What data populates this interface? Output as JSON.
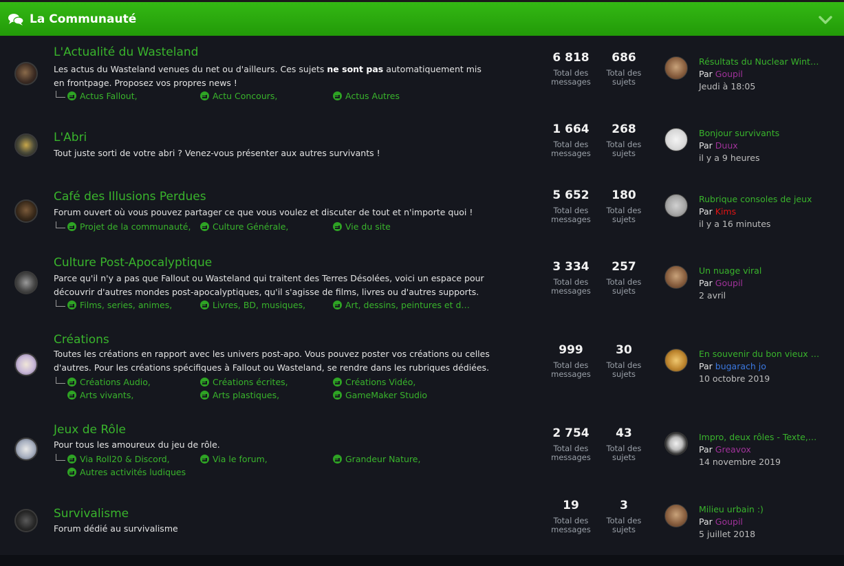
{
  "header": {
    "title": "La Communauté",
    "chat_icon": "chat-bubbles-icon",
    "collapse_icon": "chevron-down-icon"
  },
  "stats_labels": {
    "messages": "Total des messages",
    "topics": "Total des sujets"
  },
  "by_label": "Par",
  "forums": [
    {
      "title": "L'Actualité du Wasteland",
      "desc_parts": [
        "Les actus du Wasteland venues du net ou d'ailleurs. Ces sujets ",
        "ne sont pas",
        " automatiquement mis en frontpage. Proposez vos propres news !"
      ],
      "subforums": [
        "Actus Fallout,",
        "Actu Concours,",
        "Actus Autres"
      ],
      "messages": "6 818",
      "topics": "686",
      "last": {
        "title": "Résultats du Nuclear Winte…",
        "author": "Goupil",
        "author_color": "#a0329a",
        "date": "Jeudi à 18:05"
      }
    },
    {
      "title": "L'Abri",
      "desc_parts": [
        "Tout juste sorti de votre abri ? Venez-vous présenter aux autres survivants !"
      ],
      "subforums": [],
      "messages": "1 664",
      "topics": "268",
      "last": {
        "title": "Bonjour survivants",
        "author": "Duux",
        "author_color": "#a0329a",
        "date": "il y a 9 heures"
      }
    },
    {
      "title": "Café des Illusions Perdues",
      "desc_parts": [
        "Forum ouvert où vous pouvez partager ce que vous voulez et discuter de tout et n'importe quoi !"
      ],
      "subforums": [
        "Projet de la communauté,",
        "Culture Générale,",
        "Vie du site"
      ],
      "messages": "5 652",
      "topics": "180",
      "last": {
        "title": "Rubrique consoles de jeux",
        "author": "Kims",
        "author_color": "#e01414",
        "date": "il y a 16 minutes"
      }
    },
    {
      "title": "Culture Post-Apocalyptique",
      "desc_parts": [
        "Parce qu'il n'y a pas que Fallout ou Wasteland qui traitent des Terres Désolées, voici un espace pour découvrir d'autres mondes post-apocalyptiques, qu'il s'agisse de films, livres ou d'autres supports."
      ],
      "subforums": [
        "Films, series, animes,",
        "Livres, BD, musiques,",
        "Art, dessins, peintures et d…"
      ],
      "messages": "3 334",
      "topics": "257",
      "last": {
        "title": "Un nuage viral",
        "author": "Goupil",
        "author_color": "#a0329a",
        "date": "2 avril"
      }
    },
    {
      "title": "Créations",
      "desc_parts": [
        "Toutes les créations en rapport avec les univers post-apo. Vous pouvez poster vos créations ou celles d'autres. Pour les créations spécifiques à Fallout ou Wasteland, se rendre dans les rubriques dédiées."
      ],
      "subforums": [
        "Créations Audio,",
        "Créations écrites,",
        "Créations Vidéo,",
        "Arts vivants,",
        "Arts plastiques,",
        "GameMaker Studio"
      ],
      "messages": "999",
      "topics": "30",
      "last": {
        "title": "En souvenir du bon vieux t…",
        "author": "bugarach jo",
        "author_color": "#3b78e0",
        "date": "10 octobre 2019"
      }
    },
    {
      "title": "Jeux de Rôle",
      "desc_parts": [
        "Pour tous les amoureux du jeu de rôle."
      ],
      "subforums": [
        "Via Roll20 & Discord,",
        "Via le forum,",
        "Grandeur Nature,",
        "Autres activités ludiques"
      ],
      "messages": "2 754",
      "topics": "43",
      "last": {
        "title": "Impro, deux rôles - Texte,…",
        "author": "Greavox",
        "author_color": "#a0329a",
        "date": "14 novembre 2019"
      }
    },
    {
      "title": "Survivalisme",
      "desc_parts": [
        "Forum dédié au survivalisme"
      ],
      "subforums": [],
      "messages": "19",
      "topics": "3",
      "last": {
        "title": "Milieu urbain :)",
        "author": "Goupil",
        "author_color": "#a0329a",
        "date": "5 juillet 2018"
      }
    }
  ]
}
